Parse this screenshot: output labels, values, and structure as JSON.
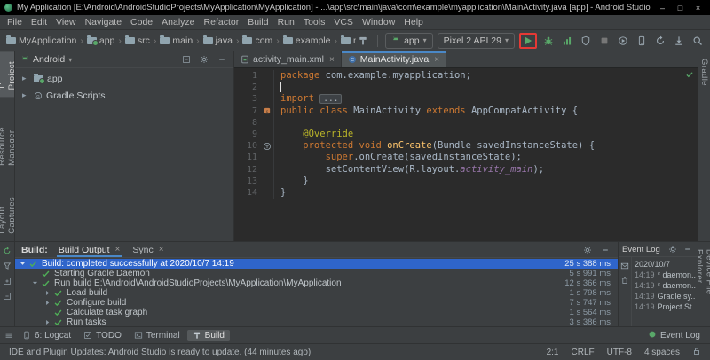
{
  "titlebar": {
    "title": "My Application [E:\\Android\\AndroidStudioProjects\\MyApplication\\MyApplication] - ...\\app\\src\\main\\java\\com\\example\\myapplication\\MainActivity.java [app] - Android Studio"
  },
  "menubar": [
    "File",
    "Edit",
    "View",
    "Navigate",
    "Code",
    "Analyze",
    "Refactor",
    "Build",
    "Run",
    "Tools",
    "VCS",
    "Window",
    "Help"
  ],
  "toolbar": {
    "breadcrumbs": [
      "MyApplication",
      "app",
      "src",
      "main",
      "java",
      "com",
      "example",
      "myapplication"
    ],
    "pre_actions": [
      {
        "name": "build-project-button",
        "type": "hammer",
        "color": "#9AA7B0"
      }
    ],
    "run_config": {
      "label": "app"
    },
    "device_selector": {
      "label": "Pixel 2 API 29"
    },
    "actions": [
      {
        "name": "run-button",
        "type": "play",
        "color": "#59A869",
        "highlight": true
      },
      {
        "name": "debug-button",
        "type": "bug",
        "color": "#59A869"
      },
      {
        "name": "profiler-button",
        "type": "profiler",
        "color": "#59A869"
      },
      {
        "name": "coverage-button",
        "type": "shield",
        "color": "#9AA7B0"
      },
      {
        "name": "stop-button",
        "type": "stop",
        "color": "#777777"
      },
      {
        "name": "attach-debugger-button",
        "type": "attach",
        "color": "#9AA7B0"
      },
      {
        "name": "device-manager-button",
        "type": "phone",
        "color": "#9AA7B0"
      },
      {
        "name": "gradle-sync-button",
        "type": "sync",
        "color": "#9AA7B0"
      },
      {
        "name": "sdk-manager-button",
        "type": "sdk",
        "color": "#9AA7B0"
      },
      {
        "name": "search-everywhere-button",
        "type": "search",
        "color": "#9AA7B0"
      }
    ]
  },
  "left_strip": {
    "top": [
      {
        "label": "1: Project",
        "active": true
      },
      {
        "label": "Resource Manager",
        "active": false
      },
      {
        "label": "Layout Captures",
        "active": false
      }
    ]
  },
  "right_strip": {
    "main": [
      {
        "label": "Gradle"
      }
    ],
    "bottom": [
      {
        "label": "Device File Explorer"
      }
    ]
  },
  "project_panel": {
    "selector": "Android",
    "tree": [
      {
        "label": "app",
        "icon": "app-folder"
      },
      {
        "label": "Gradle Scripts",
        "icon": "gradle"
      }
    ]
  },
  "editor": {
    "tabs": [
      {
        "label": "activity_main.xml",
        "icon": "layout-file",
        "active": false
      },
      {
        "label": "MainActivity.java",
        "icon": "java-class",
        "active": true
      }
    ],
    "code": [
      {
        "num": "1",
        "tokens": [
          [
            "package ",
            "kw"
          ],
          [
            "com.example.myapplication;",
            "pl"
          ]
        ]
      },
      {
        "num": "2",
        "tokens": [],
        "caret": true
      },
      {
        "num": "3",
        "tokens": [
          [
            "import ",
            "kw"
          ],
          [
            "...",
            "fold"
          ]
        ]
      },
      {
        "num": "7",
        "tokens": [
          [
            "public class ",
            "kw"
          ],
          [
            "MainActivity ",
            "pl"
          ],
          [
            "extends ",
            "kw"
          ],
          [
            "AppCompatActivity {",
            "pl"
          ]
        ],
        "gutter": "class-marker"
      },
      {
        "num": "8",
        "tokens": []
      },
      {
        "num": "9",
        "tokens": [
          [
            "    @Override",
            "ann"
          ]
        ]
      },
      {
        "num": "10",
        "tokens": [
          [
            "    protected void ",
            "kw"
          ],
          [
            "onCreate",
            "method"
          ],
          [
            "(Bundle savedInstanceState) {",
            "pl"
          ]
        ],
        "gutter": "override-marker"
      },
      {
        "num": "11",
        "tokens": [
          [
            "        super",
            "kw"
          ],
          [
            ".onCreate(savedInstanceState);",
            "pl"
          ]
        ]
      },
      {
        "num": "12",
        "tokens": [
          [
            "        setContentView(R.layout.",
            "pl"
          ],
          [
            "activity_main",
            "field"
          ],
          [
            ");",
            "pl"
          ]
        ]
      },
      {
        "num": "13",
        "tokens": [
          [
            "    }",
            "pl"
          ]
        ]
      },
      {
        "num": "14",
        "tokens": [
          [
            "}",
            "pl"
          ]
        ]
      }
    ]
  },
  "build_panel": {
    "label": "Build:",
    "tabs": [
      {
        "label": "Build Output",
        "active": true
      },
      {
        "label": "Sync",
        "active": false
      }
    ],
    "tree": [
      {
        "indent": 0,
        "arrow": "down",
        "text": "Build: completed successfully at 2020/10/7 14:19",
        "time": "25 s 388 ms",
        "selected": true
      },
      {
        "indent": 1,
        "arrow": "none",
        "text": "Starting Gradle Daemon",
        "time": "5 s 991 ms",
        "selected": false
      },
      {
        "indent": 1,
        "arrow": "down",
        "text": "Run build E:\\Android\\AndroidStudioProjects\\MyApplication\\MyApplication",
        "time": "12 s 366 ms",
        "selected": false
      },
      {
        "indent": 2,
        "arrow": "right",
        "text": "Load build",
        "time": "1 s 798 ms",
        "selected": false
      },
      {
        "indent": 2,
        "arrow": "right",
        "text": "Configure build",
        "time": "7 s 747 ms",
        "selected": false
      },
      {
        "indent": 2,
        "arrow": "none",
        "text": "Calculate task graph",
        "time": "1 s 564 ms",
        "selected": false
      },
      {
        "indent": 2,
        "arrow": "right",
        "text": "Run tasks",
        "time": "3 s 386 ms",
        "selected": false
      }
    ]
  },
  "event_log": {
    "title": "Event Log",
    "entries": [
      {
        "time": "",
        "text": "2020/10/7"
      },
      {
        "time": "14:19",
        "text": "* daemon..."
      },
      {
        "time": "14:19",
        "text": "* daemon..."
      },
      {
        "time": "14:19",
        "text": "Gradle sy..."
      },
      {
        "time": "14:19",
        "text": "Project St..."
      }
    ]
  },
  "bottom_bar": {
    "tabs": [
      {
        "label": "6: Logcat",
        "icon": "phone",
        "active": false
      },
      {
        "label": "TODO",
        "icon": "todo",
        "active": false
      },
      {
        "label": "Terminal",
        "icon": "terminal",
        "active": false
      },
      {
        "label": "Build",
        "icon": "hammer",
        "active": true
      }
    ],
    "event_log_label": "Event Log"
  },
  "status_bar": {
    "message": "IDE and Plugin Updates: Android Studio is ready to update. (44 minutes ago)",
    "caret_position": "2:1",
    "line_separator": "CRLF",
    "encoding": "UTF-8",
    "indent": "4 spaces"
  },
  "colors": {
    "accent_blue": "#4A88C7",
    "selection_blue": "#2F65CA",
    "success_green": "#59A869",
    "highlight_red": "#E53935",
    "keyword_orange": "#CC7832",
    "annotation_yellow": "#BBB529",
    "method_yellow": "#FFC66D",
    "field_purple": "#9876AA"
  }
}
